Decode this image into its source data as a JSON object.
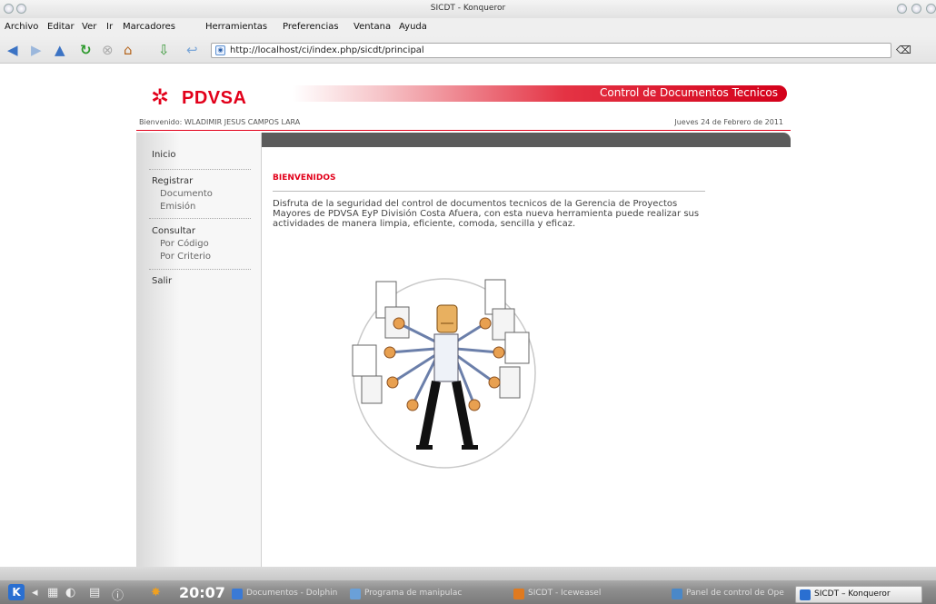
{
  "window": {
    "title": "SICDT - Konqueror"
  },
  "menu": [
    "Archivo",
    "Editar",
    "Ver",
    "Ir",
    "Marcadores",
    "Herramientas",
    "Preferencias",
    "Ventana",
    "Ayuda"
  ],
  "toolbar": {
    "url": "http://localhost/ci/index.php/sicdt/principal",
    "icons": [
      "back-icon",
      "forward-icon",
      "up-icon",
      "reload-icon",
      "stop-icon",
      "home-icon",
      "download-icon",
      "clear-url-icon"
    ]
  },
  "page": {
    "logo_text": "PDVSA",
    "banner_title": "Control de Documentos Tecnicos",
    "welcome": "Bienvenido: WLADIMIR JESUS CAMPOS LARA",
    "date": "Jueves 24 de Febrero de 2011",
    "sidebar": {
      "inicio": "Inicio",
      "registrar": "Registrar",
      "documento": "Documento",
      "emision": "Emisión",
      "consultar": "Consultar",
      "por_codigo": "Por Código",
      "por_criterio": "Por Criterio",
      "salir": "Salir"
    },
    "main": {
      "heading": "BIENVENIDOS",
      "paragraph": "Disfruta de la seguridad del control de documentos tecnicos de la Gerencia de Proyectos Mayores de PDVSA EyP División Costa Afuera, con esta nueva herramienta puede realizar sus actividades de manera limpia, eficiente, comoda, sencilla y eficaz."
    }
  },
  "taskbar": {
    "clock": "20:07",
    "tasks": [
      {
        "label": "Documentos - Dolphin",
        "icon_color": "#3a7ad6"
      },
      {
        "label": "Programa de manipulac",
        "icon_color": "#6aa0d8"
      },
      {
        "label": "SICDT - Iceweasel",
        "icon_color": "#e07a1f"
      },
      {
        "label": "Panel de control de Ope",
        "icon_color": "#4a88c8"
      },
      {
        "label": "SICDT – Konqueror",
        "icon_color": "#2a6fd1",
        "active": true
      }
    ]
  },
  "colors": {
    "brand_red": "#e2001a",
    "dark_bar": "#5b5b5b"
  }
}
